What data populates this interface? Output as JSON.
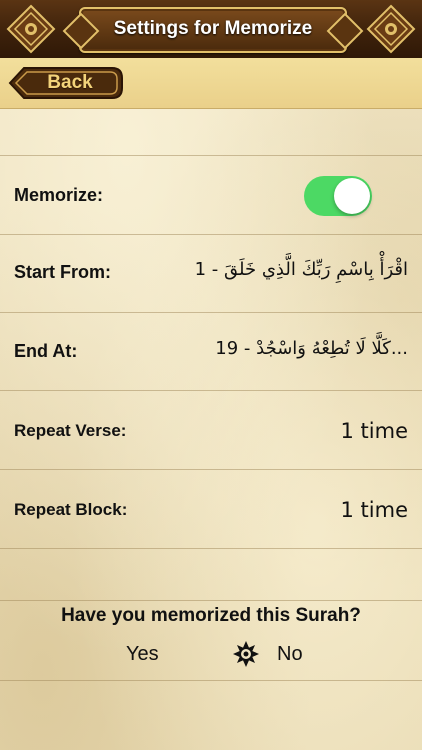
{
  "header": {
    "title": "Settings for Memorize",
    "back_label": "Back"
  },
  "settings": {
    "memorize": {
      "label": "Memorize:",
      "enabled": true
    },
    "start_from": {
      "label": "Start From:",
      "value": "1 - اقْرَأْ بِاسْمِ رَبِّكَ الَّذِي خَلَقَ"
    },
    "end_at": {
      "label": "End At:",
      "value": "19 - كَلَّا لَا تُطِعْهُ وَاسْجُدْ..."
    },
    "repeat_verse": {
      "label": "Repeat Verse:",
      "value": "1 time"
    },
    "repeat_block": {
      "label": "Repeat Block:",
      "value": "1 time"
    }
  },
  "question": {
    "text": "Have you memorized this Surah?",
    "yes_label": "Yes",
    "no_label": "No"
  },
  "colors": {
    "toggle_on": "#4cd964",
    "header_brown": "#3e220b",
    "gold_trim": "#e2c06a"
  }
}
